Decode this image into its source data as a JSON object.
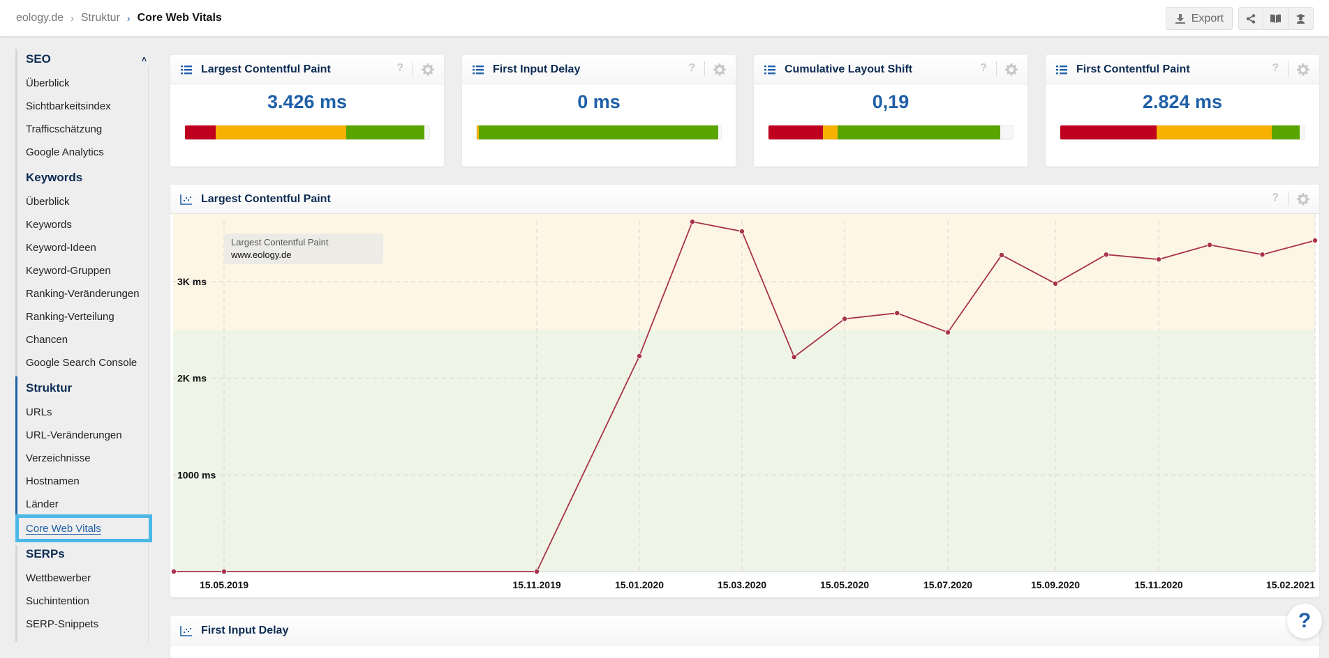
{
  "breadcrumb": {
    "items": [
      "eology.de",
      "Struktur"
    ],
    "current": "Core Web Vitals"
  },
  "toolbar": {
    "export_label": "Export",
    "icons": [
      "download-icon",
      "share-icon",
      "book-icon",
      "academy-icon"
    ]
  },
  "sidebar": {
    "sections": [
      {
        "label": "SEO",
        "items": [
          "Überblick",
          "Sichtbarkeitsindex",
          "Trafficschätzung",
          "Google Analytics"
        ]
      },
      {
        "label": "Keywords",
        "items": [
          "Überblick",
          "Keywords",
          "Keyword-Ideen",
          "Keyword-Gruppen",
          "Ranking-Veränderungen",
          "Ranking-Verteilung",
          "Chancen",
          "Google Search Console"
        ]
      },
      {
        "label": "Struktur",
        "items": [
          "URLs",
          "URL-Veränderungen",
          "Verzeichnisse",
          "Hostnamen",
          "Länder",
          "Core Web Vitals"
        ]
      },
      {
        "label": "SERPs",
        "items": [
          "Wettbewerber",
          "Suchintention",
          "SERP-Snippets"
        ]
      }
    ],
    "active_item": "Core Web Vitals"
  },
  "kpis": [
    {
      "title": "Largest Contentful Paint",
      "value": "3.426 ms",
      "distribution": {
        "poor": 0.125,
        "needs_improvement": 0.535,
        "good": 0.32
      }
    },
    {
      "title": "First Input Delay",
      "value": "0 ms",
      "distribution": {
        "poor": 0.0,
        "needs_improvement": 0.008,
        "good": 0.982
      }
    },
    {
      "title": "Cumulative Layout Shift",
      "value": "0,19",
      "distribution": {
        "poor": 0.222,
        "needs_improvement": 0.06,
        "good": 0.668
      }
    },
    {
      "title": "First Contentful Paint",
      "value": "2.824 ms",
      "distribution": {
        "poor": 0.395,
        "needs_improvement": 0.47,
        "good": 0.115
      }
    }
  ],
  "colors": {
    "poor": "#c0001f",
    "needs_improvement": "#f7b100",
    "good": "#5aa400",
    "accent": "#1f5fa8",
    "line": "#a8324a",
    "band_good": "#eef5e6",
    "band_ni": "#fdf6e5",
    "highlight": "#4cb8e6"
  },
  "chart_card": {
    "title": "Largest Contentful Paint"
  },
  "second_card": {
    "title": "First Input Delay"
  },
  "chart_data": {
    "type": "line",
    "title": "Largest Contentful Paint",
    "legend": {
      "title": "Largest Contentful Paint",
      "series_name": "www.eology.de",
      "placement": "top-left"
    },
    "x_tick_labels": [
      "15.05.2019",
      "15.11.2019",
      "15.01.2020",
      "15.03.2020",
      "15.05.2020",
      "15.07.2020",
      "15.09.2020",
      "15.11.2020",
      "15.02.2021"
    ],
    "x_tick_dates": [
      "2019-05-15",
      "2019-11-15",
      "2020-01-15",
      "2020-03-15",
      "2020-05-15",
      "2020-07-15",
      "2020-09-15",
      "2020-11-15",
      "2021-02-15"
    ],
    "y_ticks": [
      {
        "value": 1000,
        "label": "1000 ms"
      },
      {
        "value": 2000,
        "label": "2K ms"
      },
      {
        "value": 3000,
        "label": "3K ms"
      }
    ],
    "ylim": [
      0,
      3700
    ],
    "bands": [
      {
        "from": 0,
        "to": 2500,
        "kind": "good"
      },
      {
        "from": 2500,
        "to": 3700,
        "kind": "needs_improvement"
      }
    ],
    "series": [
      {
        "name": "www.eology.de",
        "points": [
          {
            "x": "2019-04-15",
            "y": 0
          },
          {
            "x": "2019-05-15",
            "y": 0
          },
          {
            "x": "2019-11-15",
            "y": 0
          },
          {
            "x": "2020-01-15",
            "y": 2230
          },
          {
            "x": "2020-02-15",
            "y": 3620
          },
          {
            "x": "2020-03-15",
            "y": 3520
          },
          {
            "x": "2020-04-15",
            "y": 2220
          },
          {
            "x": "2020-05-15",
            "y": 2615
          },
          {
            "x": "2020-06-15",
            "y": 2675
          },
          {
            "x": "2020-07-15",
            "y": 2475
          },
          {
            "x": "2020-08-15",
            "y": 3275
          },
          {
            "x": "2020-09-15",
            "y": 2980
          },
          {
            "x": "2020-10-15",
            "y": 3280
          },
          {
            "x": "2020-11-15",
            "y": 3230
          },
          {
            "x": "2020-12-15",
            "y": 3380
          },
          {
            "x": "2021-01-15",
            "y": 3280
          },
          {
            "x": "2021-02-15",
            "y": 3426
          }
        ]
      }
    ]
  }
}
